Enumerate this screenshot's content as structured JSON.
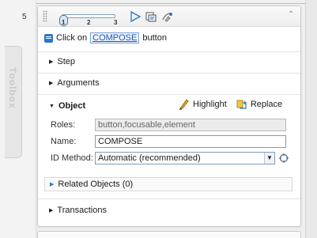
{
  "step": {
    "number": "5"
  },
  "toolbox": {
    "label": "Toolbox"
  },
  "toolbar": {
    "slider": {
      "ticks": [
        "1",
        "2",
        "3"
      ],
      "level": 1
    },
    "icons": [
      "play-icon",
      "record-icon",
      "highlight-run-icon",
      "collapse-icon"
    ]
  },
  "description": {
    "prefix": "Click on",
    "link": "COMPOSE",
    "suffix": "button"
  },
  "sections": {
    "step": "Step",
    "arguments": "Arguments",
    "object": "Object",
    "transactions": "Transactions"
  },
  "object": {
    "actions": {
      "highlight": "Highlight",
      "replace": "Replace"
    },
    "roles_label": "Roles:",
    "roles_value": "button,focusable,element",
    "name_label": "Name:",
    "name_value": "COMPOSE",
    "method_label": "ID Method:",
    "method_value": "Automatic (recommended)",
    "related": "Related Objects (0)"
  },
  "colors": {
    "accent": "#2b76c8",
    "link": "#1f58b3",
    "highlight_icon": "#f0a020"
  }
}
